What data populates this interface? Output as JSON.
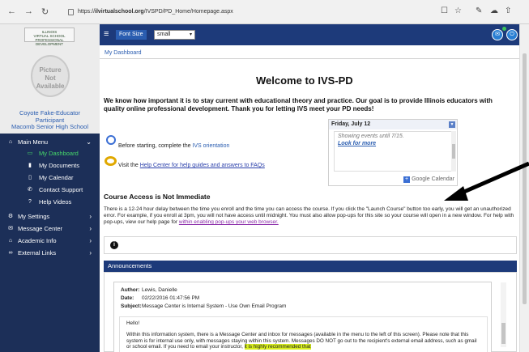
{
  "browser": {
    "url_prefix": "https://",
    "url_host": "ilvirtualschool.org",
    "url_path": "/IVSPD/PD_Home/Homepage.aspx",
    "back": "←",
    "forward": "→",
    "refresh": "↻",
    "actions": [
      "☐",
      "☆",
      "✎",
      "☁",
      "⇧"
    ]
  },
  "sidebar": {
    "logo_lines": [
      "ILLINOIS",
      "VIRTUAL SCHOOL",
      "PROFESSIONAL DEVELOPMENT"
    ],
    "avatar_text": [
      "Picture",
      "Not",
      "Available"
    ],
    "user_name": "Coyote Fake-Educator",
    "user_role": "Participant",
    "user_school": "Macomb Senior High School",
    "menu": [
      {
        "label": "Main Menu",
        "icon": "home-icon",
        "glyph": "⌂",
        "chevron": "⌄"
      },
      {
        "label": "My Dashboard",
        "icon": "dashboard-icon",
        "glyph": "▭",
        "sub": true,
        "active": true
      },
      {
        "label": "My Documents",
        "icon": "document-icon",
        "glyph": "▮",
        "sub": true
      },
      {
        "label": "My Calendar",
        "icon": "calendar-icon",
        "glyph": "▯",
        "sub": true
      },
      {
        "label": "Contact Support",
        "icon": "phone-icon",
        "glyph": "✆",
        "sub": true
      },
      {
        "label": "Help Videos",
        "icon": "question-icon",
        "glyph": "?",
        "sub": true
      },
      {
        "label": "My Settings",
        "icon": "gear-icon",
        "glyph": "⚙",
        "chevron": "›"
      },
      {
        "label": "Message Center",
        "icon": "message-icon",
        "glyph": "✉",
        "chevron": "›"
      },
      {
        "label": "Academic Info",
        "icon": "graduation-icon",
        "glyph": "⌂",
        "chevron": "›"
      },
      {
        "label": "External Links",
        "icon": "link-icon",
        "glyph": "∞",
        "chevron": "›"
      }
    ]
  },
  "topbar": {
    "font_size_label": "Font Size",
    "font_size_value": "small",
    "mail_glyph": "✉",
    "logout_glyph": "⏻"
  },
  "breadcrumb": "My Dashboard",
  "welcome_title": "Welcome to IVS-PD",
  "intro_text": "We know how important it is to stay current with educational theory and practice. Our goal is to provide Illinois educators with quality online professional development. Thank you for letting IVS meet your PD needs!",
  "calendar": {
    "date": "Friday, July 12",
    "events_note": "Showing events until 7/15.",
    "look_more": "Look for more",
    "google_label": "Google Calendar"
  },
  "orientation": {
    "before": "Before starting, complete the ",
    "link": "IVS orientation"
  },
  "helpcenter": {
    "before": "Visit the ",
    "link": "Help Center for help guides and answers to FAQs"
  },
  "access": {
    "heading": "Course Access is Not Immediate",
    "text": "There is a 12-24 hour delay between the time you enroll and the time you can access the course. If you click the \"Launch Course\" button too early, you will get an unauthorized error. For example, if you enroll at 3pm, you will not have access until midnight. You must also allow pop-ups for this site so your course will open in a new window. For help with pop-ups, view our help page for ",
    "link": "within enabling pop-ups your web browser."
  },
  "info_glyph": "i",
  "announcements": {
    "heading": "Announcements",
    "author_label": "Author:",
    "author": "Lewis, Danielle",
    "date_label": "Date:",
    "date": "02/22/2016 01:47:56 PM",
    "subject_label": "Subject:",
    "subject": "Message Center is Internal System - Use Own Email Program",
    "greeting": "Hello!",
    "body": "Within this information system, there is a Message Center and inbox for messages (available in the menu to the left of this screen). Please note that this system is for internal use only, with messages staying within this system. Messages DO NOT go out to the recipient's external email address, such as gmail or school email. If you need to email your instructor, ",
    "body_highlight": "it is highly recommended that"
  }
}
